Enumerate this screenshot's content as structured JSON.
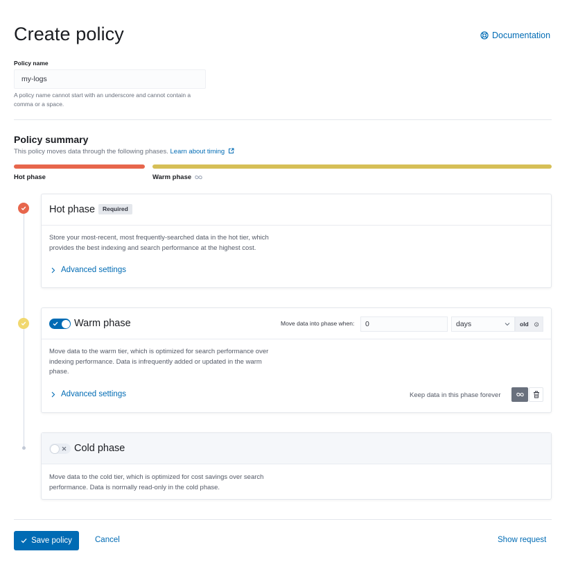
{
  "header": {
    "title": "Create policy",
    "doc_link": "Documentation"
  },
  "policy_name": {
    "label": "Policy name",
    "value": "my-logs",
    "help": "A policy name cannot start with an underscore and cannot contain a comma or a space."
  },
  "summary": {
    "title": "Policy summary",
    "description": "This policy moves data through the following phases.",
    "link": "Learn about timing",
    "bars": [
      {
        "label": "Hot phase",
        "color": "#e7664c"
      },
      {
        "label": "Warm phase",
        "color": "#d6bf57"
      }
    ]
  },
  "phases": {
    "hot": {
      "title": "Hot phase",
      "badge": "Required",
      "description_line1": "Store your most-recent, most frequently-searched data in the hot tier, which",
      "description_line2": "provides the best indexing and search performance at the highest cost.",
      "advanced": "Advanced settings",
      "color": "#e7664c"
    },
    "warm": {
      "title": "Warm phase",
      "enabled": true,
      "move_label": "Move data into phase when:",
      "age_value": "0",
      "unit": "days",
      "append": "old",
      "description_line1": "Move data to the warm tier, which is optimized for search performance over",
      "description_line2": "indexing performance. Data is infrequently added or updated in the warm",
      "description_line3": "phase.",
      "advanced": "Advanced settings",
      "keep_label": "Keep data in this phase forever",
      "color": "#d6bf57"
    },
    "cold": {
      "title": "Cold phase",
      "enabled": false,
      "description_line1": "Move data to the cold tier, which is optimized for cost savings over search",
      "description_line2": "performance. Data is normally read-only in the cold phase."
    }
  },
  "footer": {
    "save": "Save policy",
    "cancel": "Cancel",
    "show_request": "Show request"
  },
  "colors": {
    "accent": "#006bb4",
    "hot": "#e7664c",
    "warm": "#d6bf57"
  }
}
